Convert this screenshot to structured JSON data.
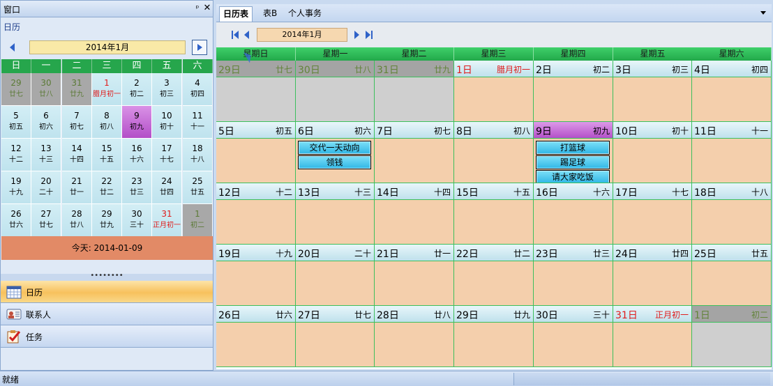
{
  "window": {
    "title": "窗口",
    "pin_glyph": "ᵖ",
    "close_glyph": "✕"
  },
  "left_panel": {
    "calendar_label": "日历",
    "month_title": "2014年1月",
    "weekday_headers": [
      "日",
      "一",
      "二",
      "三",
      "四",
      "五",
      "六"
    ],
    "weeks": [
      [
        {
          "day": "29",
          "lunar": "廿七",
          "kind": "other"
        },
        {
          "day": "30",
          "lunar": "廿八",
          "kind": "other"
        },
        {
          "day": "31",
          "lunar": "廿九",
          "kind": "other"
        },
        {
          "day": "1",
          "lunar": "腊月初一",
          "kind": "red"
        },
        {
          "day": "2",
          "lunar": "初二",
          "kind": ""
        },
        {
          "day": "3",
          "lunar": "初三",
          "kind": ""
        },
        {
          "day": "4",
          "lunar": "初四",
          "kind": ""
        }
      ],
      [
        {
          "day": "5",
          "lunar": "初五",
          "kind": ""
        },
        {
          "day": "6",
          "lunar": "初六",
          "kind": ""
        },
        {
          "day": "7",
          "lunar": "初七",
          "kind": ""
        },
        {
          "day": "8",
          "lunar": "初八",
          "kind": ""
        },
        {
          "day": "9",
          "lunar": "初九",
          "kind": "today"
        },
        {
          "day": "10",
          "lunar": "初十",
          "kind": ""
        },
        {
          "day": "11",
          "lunar": "十一",
          "kind": ""
        }
      ],
      [
        {
          "day": "12",
          "lunar": "十二",
          "kind": ""
        },
        {
          "day": "13",
          "lunar": "十三",
          "kind": ""
        },
        {
          "day": "14",
          "lunar": "十四",
          "kind": ""
        },
        {
          "day": "15",
          "lunar": "十五",
          "kind": ""
        },
        {
          "day": "16",
          "lunar": "十六",
          "kind": ""
        },
        {
          "day": "17",
          "lunar": "十七",
          "kind": ""
        },
        {
          "day": "18",
          "lunar": "十八",
          "kind": ""
        }
      ],
      [
        {
          "day": "19",
          "lunar": "十九",
          "kind": ""
        },
        {
          "day": "20",
          "lunar": "二十",
          "kind": ""
        },
        {
          "day": "21",
          "lunar": "廿一",
          "kind": ""
        },
        {
          "day": "22",
          "lunar": "廿二",
          "kind": ""
        },
        {
          "day": "23",
          "lunar": "廿三",
          "kind": ""
        },
        {
          "day": "24",
          "lunar": "廿四",
          "kind": ""
        },
        {
          "day": "25",
          "lunar": "廿五",
          "kind": ""
        }
      ],
      [
        {
          "day": "26",
          "lunar": "廿六",
          "kind": ""
        },
        {
          "day": "27",
          "lunar": "廿七",
          "kind": ""
        },
        {
          "day": "28",
          "lunar": "廿八",
          "kind": ""
        },
        {
          "day": "29",
          "lunar": "廿九",
          "kind": ""
        },
        {
          "day": "30",
          "lunar": "三十",
          "kind": ""
        },
        {
          "day": "31",
          "lunar": "正月初一",
          "kind": "red"
        },
        {
          "day": "1",
          "lunar": "初二",
          "kind": "other"
        }
      ]
    ],
    "today_text": "今天: 2014-01-09",
    "splitter_glyph": "••••••••",
    "nav_buttons": [
      {
        "label": "日历",
        "icon": "calendar-icon",
        "active": true
      },
      {
        "label": "联系人",
        "icon": "contacts-icon",
        "active": false
      },
      {
        "label": "任务",
        "icon": "tasks-icon",
        "active": false
      }
    ]
  },
  "tabs": [
    {
      "label": "日历表",
      "active": true
    },
    {
      "label": "表B",
      "active": false
    },
    {
      "label": "个人事务",
      "active": false
    }
  ],
  "main": {
    "month_title": "2014年1月",
    "weekday_headers": [
      "星期日",
      "星期一",
      "星期二",
      "星期三",
      "星期四",
      "星期五",
      "星期六"
    ],
    "weeks": [
      [
        {
          "day": "29日",
          "lunar": "廿七",
          "kind": "other",
          "events": []
        },
        {
          "day": "30日",
          "lunar": "廿八",
          "kind": "other",
          "events": []
        },
        {
          "day": "31日",
          "lunar": "廿九",
          "kind": "other",
          "events": []
        },
        {
          "day": "1日",
          "lunar": "腊月初一",
          "kind": "red",
          "events": []
        },
        {
          "day": "2日",
          "lunar": "初二",
          "kind": "",
          "events": []
        },
        {
          "day": "3日",
          "lunar": "初三",
          "kind": "",
          "events": []
        },
        {
          "day": "4日",
          "lunar": "初四",
          "kind": "",
          "events": []
        }
      ],
      [
        {
          "day": "5日",
          "lunar": "初五",
          "kind": "",
          "events": []
        },
        {
          "day": "6日",
          "lunar": "初六",
          "kind": "",
          "events": [
            "交代一天动向",
            "领钱"
          ]
        },
        {
          "day": "7日",
          "lunar": "初七",
          "kind": "",
          "events": []
        },
        {
          "day": "8日",
          "lunar": "初八",
          "kind": "",
          "events": []
        },
        {
          "day": "9日",
          "lunar": "初九",
          "kind": "today",
          "events": [
            "打篮球",
            "踢足球",
            "请大家吃饭"
          ]
        },
        {
          "day": "10日",
          "lunar": "初十",
          "kind": "",
          "events": []
        },
        {
          "day": "11日",
          "lunar": "十一",
          "kind": "",
          "events": []
        }
      ],
      [
        {
          "day": "12日",
          "lunar": "十二",
          "kind": "",
          "events": []
        },
        {
          "day": "13日",
          "lunar": "十三",
          "kind": "",
          "events": []
        },
        {
          "day": "14日",
          "lunar": "十四",
          "kind": "",
          "events": []
        },
        {
          "day": "15日",
          "lunar": "十五",
          "kind": "",
          "events": []
        },
        {
          "day": "16日",
          "lunar": "十六",
          "kind": "",
          "events": []
        },
        {
          "day": "17日",
          "lunar": "十七",
          "kind": "",
          "events": []
        },
        {
          "day": "18日",
          "lunar": "十八",
          "kind": "",
          "events": []
        }
      ],
      [
        {
          "day": "19日",
          "lunar": "十九",
          "kind": "",
          "events": []
        },
        {
          "day": "20日",
          "lunar": "二十",
          "kind": "",
          "events": []
        },
        {
          "day": "21日",
          "lunar": "廿一",
          "kind": "",
          "events": []
        },
        {
          "day": "22日",
          "lunar": "廿二",
          "kind": "",
          "events": []
        },
        {
          "day": "23日",
          "lunar": "廿三",
          "kind": "",
          "events": []
        },
        {
          "day": "24日",
          "lunar": "廿四",
          "kind": "",
          "events": []
        },
        {
          "day": "25日",
          "lunar": "廿五",
          "kind": "",
          "events": []
        }
      ],
      [
        {
          "day": "26日",
          "lunar": "廿六",
          "kind": "",
          "events": []
        },
        {
          "day": "27日",
          "lunar": "廿七",
          "kind": "",
          "events": []
        },
        {
          "day": "28日",
          "lunar": "廿八",
          "kind": "",
          "events": []
        },
        {
          "day": "29日",
          "lunar": "廿九",
          "kind": "",
          "events": []
        },
        {
          "day": "30日",
          "lunar": "三十",
          "kind": "",
          "events": []
        },
        {
          "day": "31日",
          "lunar": "正月初一",
          "kind": "red",
          "events": []
        },
        {
          "day": "1日",
          "lunar": "初二",
          "kind": "other",
          "events": []
        }
      ]
    ]
  },
  "status": {
    "text": "就绪"
  }
}
